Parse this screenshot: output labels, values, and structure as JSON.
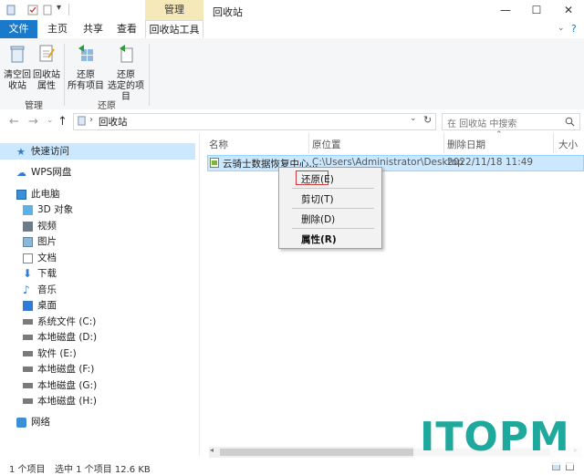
{
  "window": {
    "title": "回收站",
    "context_tab": "管理",
    "controls": {
      "minimize": "—",
      "maximize": "☐",
      "close": "✕"
    }
  },
  "ribbon": {
    "tabs": [
      {
        "label": "文件"
      },
      {
        "label": "主页"
      },
      {
        "label": "共享"
      },
      {
        "label": "查看"
      },
      {
        "label": "回收站工具"
      }
    ],
    "buttons": {
      "empty_bin": "清空回\n收站",
      "bin_props": "回收站\n属性",
      "restore_all": "还原\n所有项目",
      "restore_selected": "还原\n选定的项目"
    },
    "groups": {
      "manage": "管理",
      "restore": "还原"
    }
  },
  "address": {
    "path": "回收站",
    "search_placeholder": "在 回收站 中搜索"
  },
  "sidebar": {
    "items": [
      {
        "label": "快速访问",
        "icon": "star-icon"
      },
      {
        "label": "WPS网盘",
        "icon": "cloud-icon"
      },
      {
        "label": "此电脑",
        "icon": "computer-icon"
      },
      {
        "label": "3D 对象",
        "icon": "cube-icon"
      },
      {
        "label": "视频",
        "icon": "video-icon"
      },
      {
        "label": "图片",
        "icon": "picture-icon"
      },
      {
        "label": "文档",
        "icon": "document-icon"
      },
      {
        "label": "下载",
        "icon": "download-icon"
      },
      {
        "label": "音乐",
        "icon": "music-icon"
      },
      {
        "label": "桌面",
        "icon": "desktop-icon"
      },
      {
        "label": "系统文件 (C:)",
        "icon": "drive-icon"
      },
      {
        "label": "本地磁盘 (D:)",
        "icon": "drive-icon"
      },
      {
        "label": "软件 (E:)",
        "icon": "drive-icon"
      },
      {
        "label": "本地磁盘 (F:)",
        "icon": "drive-icon"
      },
      {
        "label": "本地磁盘 (G:)",
        "icon": "drive-icon"
      },
      {
        "label": "本地磁盘 (H:)",
        "icon": "drive-icon"
      },
      {
        "label": "网络",
        "icon": "network-icon"
      }
    ]
  },
  "list": {
    "columns": [
      "名称",
      "原位置",
      "删除日期",
      "大小"
    ],
    "rows": [
      {
        "name": "云骑士数据恢复中心...",
        "location": "C:\\Users\\Administrator\\Desktop",
        "date": "2022/11/18 11:49"
      }
    ]
  },
  "context_menu": {
    "items": [
      "还原(E)",
      "剪切(T)",
      "删除(D)",
      "属性(R)"
    ]
  },
  "status": {
    "count": "1 个项目",
    "selected": "选中 1 个项目  12.6 KB"
  },
  "watermark": {
    "text": "ITOPM"
  },
  "colors": {
    "accent": "#1979ca",
    "selection": "#cce8ff",
    "brand": "#1fa89c",
    "context_tab": "#f6e9b9"
  }
}
